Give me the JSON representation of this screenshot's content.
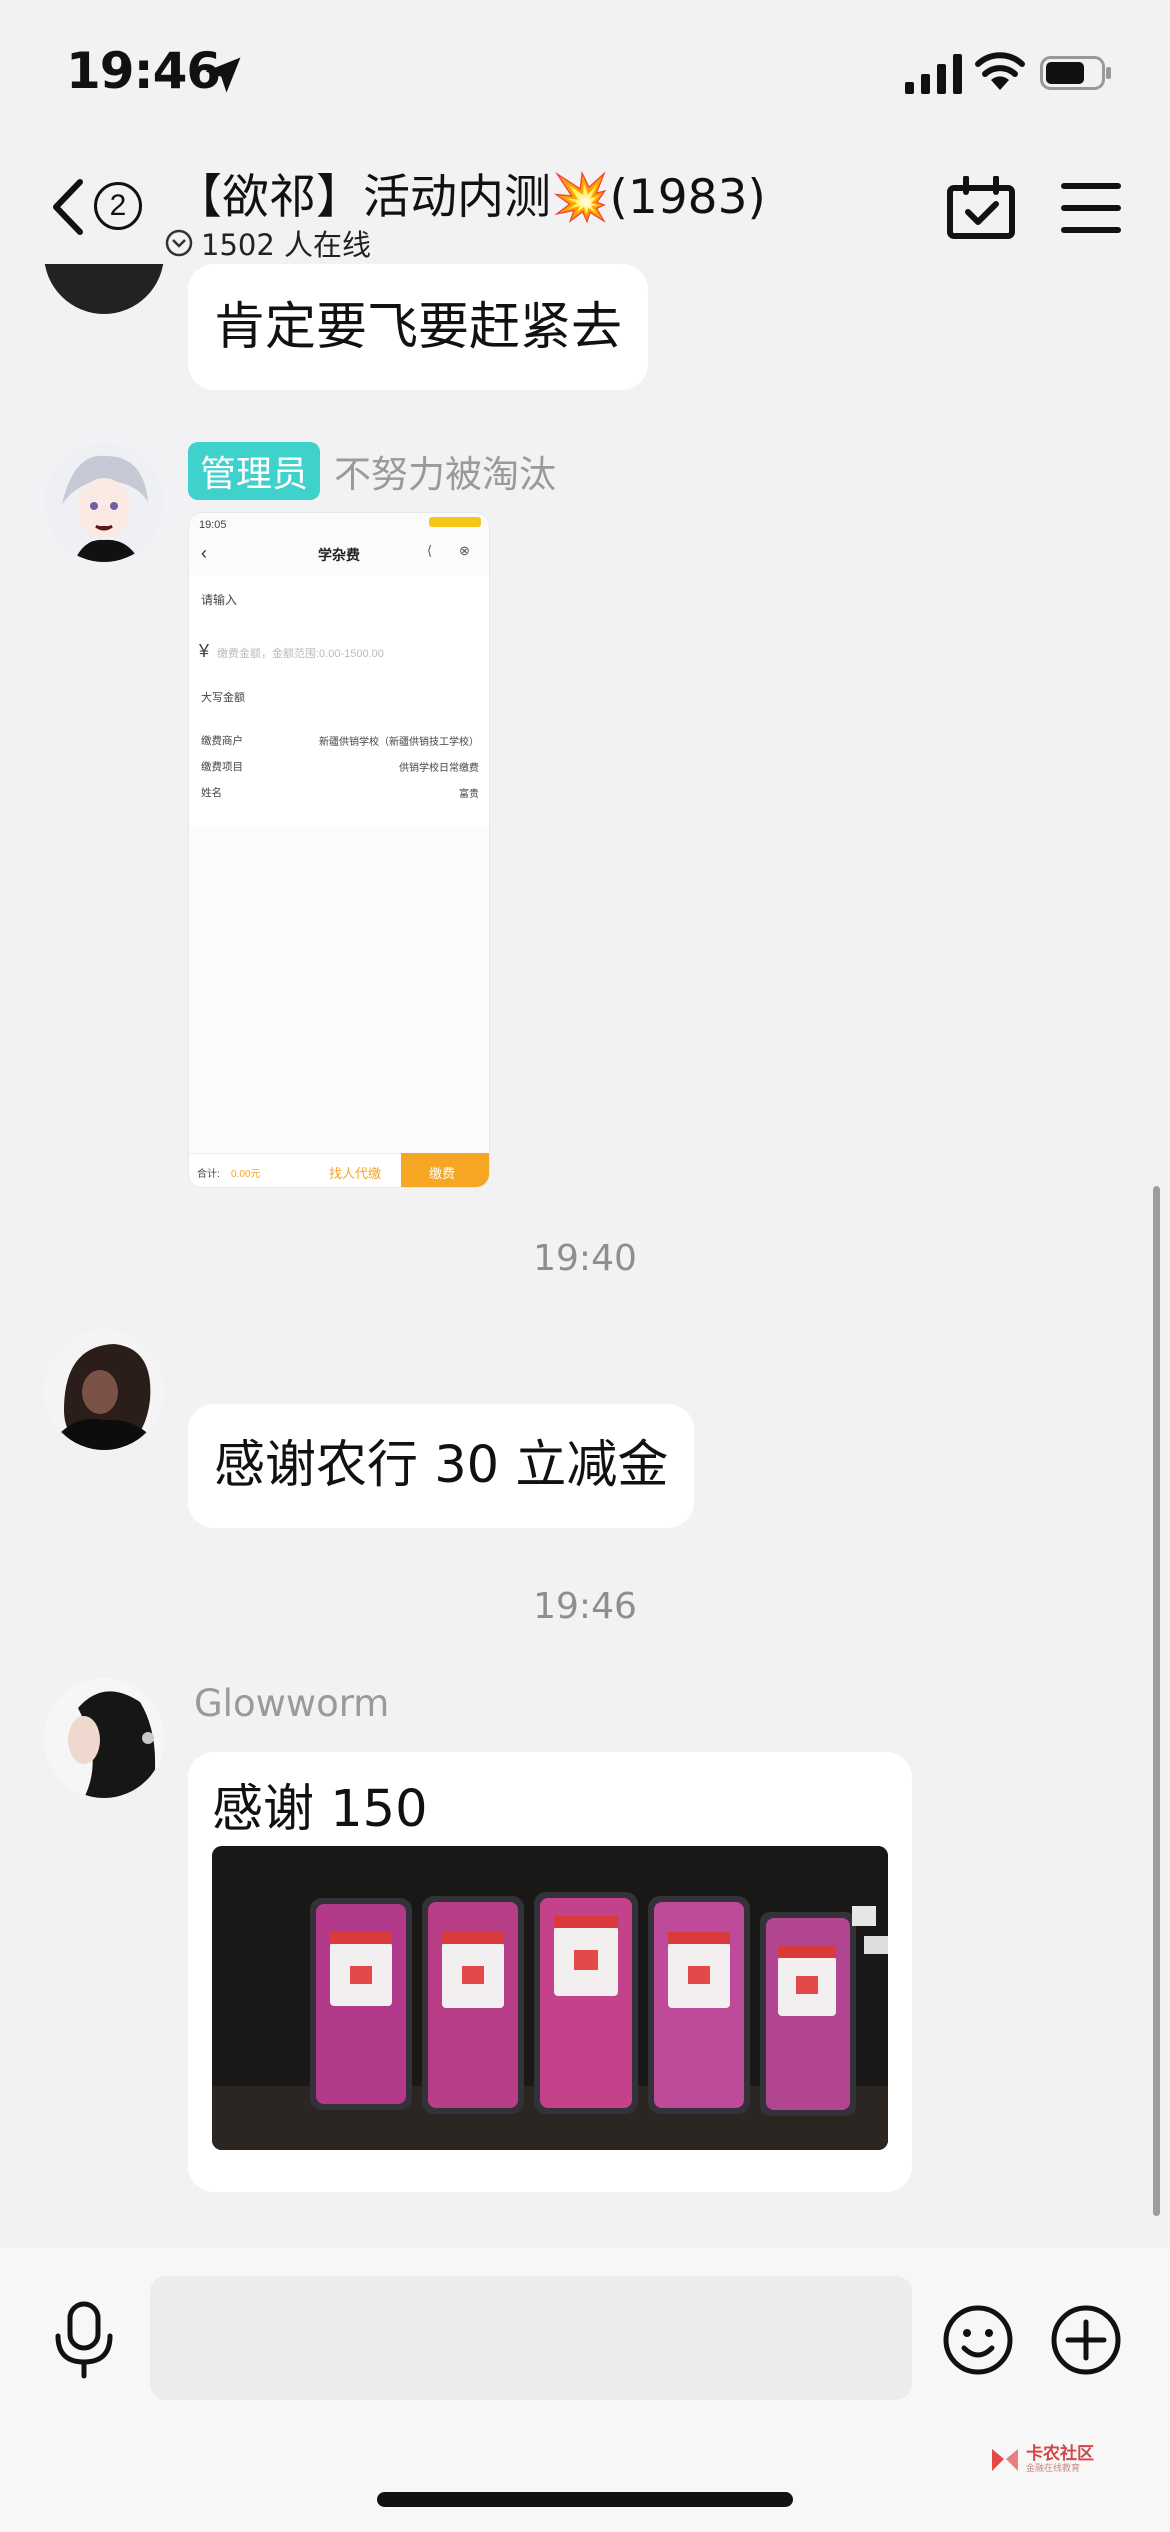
{
  "status_bar": {
    "time": "19:46"
  },
  "header": {
    "unread_count": "2",
    "title": "【欲祁】活动内测💥(1983)",
    "online_text": "1502 人在线"
  },
  "messages": [
    {
      "text": "肯定要飞要赶紧去"
    },
    {
      "badge": "管理员",
      "sender": "不努力被淘汰",
      "screenshot": {
        "time": "19:05",
        "title": "学杂费",
        "input_label": "请输入",
        "currency": "¥",
        "amount_placeholder": "缴费金额，金额范围:0.00-1500.00",
        "capital_label": "大写金额",
        "rows": [
          {
            "label": "缴费商户",
            "value": "新疆供销学校（新疆供销技工学校）"
          },
          {
            "label": "缴费项目",
            "value": "供销学校日常缴费"
          },
          {
            "label": "姓名",
            "value": "富贵"
          }
        ],
        "total_label": "合计:",
        "total_value": "0.00元",
        "proxy_button": "找人代缴",
        "pay_button": "缴费"
      }
    },
    {
      "time_separator": "19:40"
    },
    {
      "text": "感谢农行 30 立减金"
    },
    {
      "time_separator": "19:46"
    },
    {
      "sender": "Glowworm",
      "text": "感谢 150"
    }
  ],
  "watermark": {
    "line1": "卡农社区",
    "line2": "金融在线教育"
  },
  "colors": {
    "admin_badge": "#3fd1cc",
    "background": "#f2f2f4",
    "pay_button": "#f5a623"
  }
}
